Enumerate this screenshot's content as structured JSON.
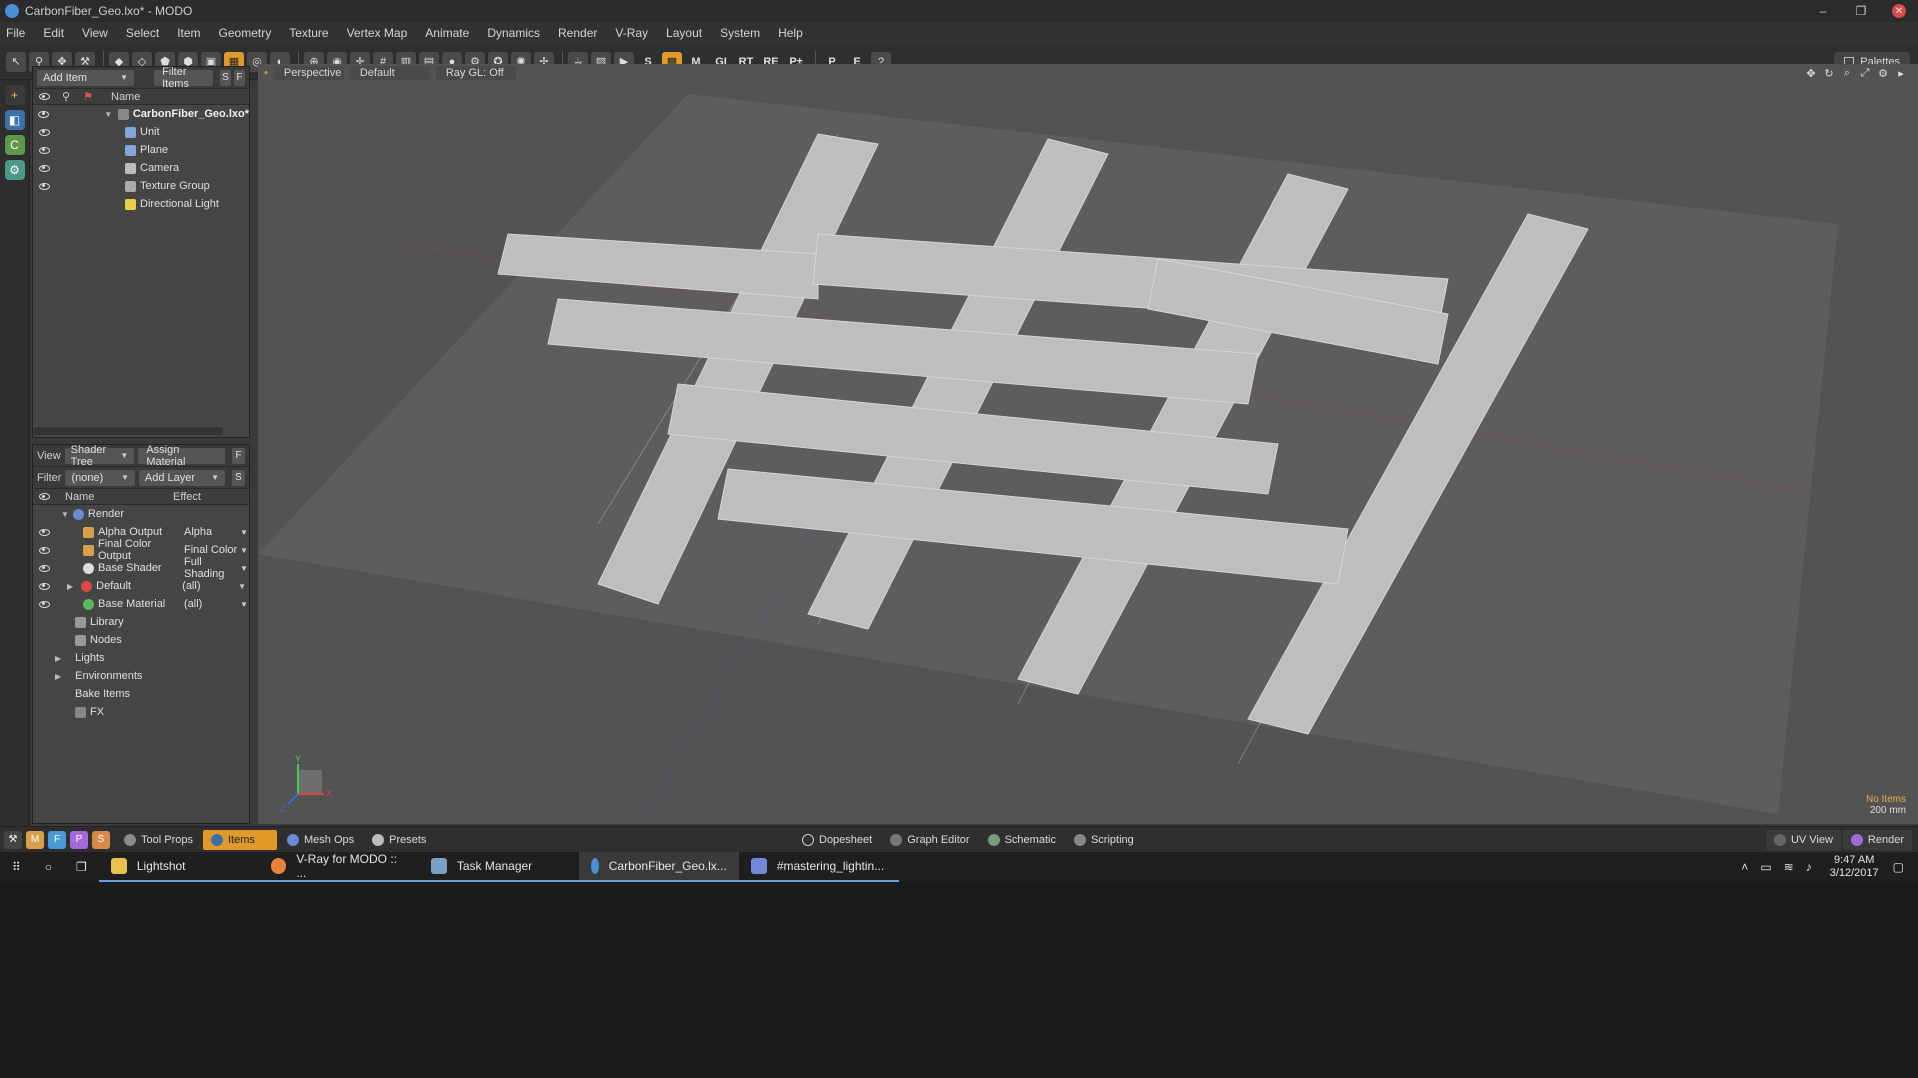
{
  "window": {
    "title": "CarbonFiber_Geo.lxo* - MODO",
    "minimize": "–",
    "restore": "❐",
    "close": "✕"
  },
  "menu": [
    "File",
    "Edit",
    "View",
    "Select",
    "Item",
    "Geometry",
    "Texture",
    "Vertex Map",
    "Animate",
    "Dynamics",
    "Render",
    "V-Ray",
    "Layout",
    "System",
    "Help"
  ],
  "toolbar": {
    "text_buttons": [
      "S",
      "M",
      "GI",
      "RT",
      "RE",
      "P±",
      "P",
      "E",
      "?"
    ],
    "palettes": "Palettes"
  },
  "items_panel": {
    "add_item": "Add Item",
    "filter_items": "Filter Items",
    "btn_s": "S",
    "btn_f": "F",
    "name_header": "Name",
    "scene_name": "CarbonFiber_Geo.lxo*",
    "items": [
      "Unit",
      "Plane",
      "Camera",
      "Texture Group",
      "Directional Light"
    ]
  },
  "shader_panel": {
    "view_label": "View",
    "view_value": "Shader Tree",
    "assign_material": "Assign Material",
    "btn_f": "F",
    "filter_label": "Filter",
    "filter_value": "(none)",
    "add_layer": "Add Layer",
    "btn_s": "S",
    "col_name": "Name",
    "col_effect": "Effect",
    "render": "Render",
    "rows": [
      {
        "name": "Alpha Output",
        "effect": "Alpha"
      },
      {
        "name": "Final Color Output",
        "effect": "Final Color"
      },
      {
        "name": "Base Shader",
        "effect": "Full Shading"
      },
      {
        "name": "Default",
        "effect": "(all)"
      },
      {
        "name": "Base Material",
        "effect": "(all)"
      }
    ],
    "groups": [
      "Library",
      "Nodes",
      "Lights",
      "Environments",
      "Bake Items",
      "FX"
    ]
  },
  "viewport": {
    "tab_perspective": "Perspective",
    "tab_default": "Default",
    "tab_raygl": "Ray GL: Off",
    "no_items": "No Items",
    "scale": "200 mm",
    "axis_x": "X",
    "axis_y": "Y",
    "axis_z": "Z"
  },
  "bottom_tabs": {
    "left": [
      "Tool Props",
      "Items",
      "Mesh Ops",
      "Presets"
    ],
    "mode_letters": [
      "M",
      "F",
      "P",
      "S"
    ],
    "center": [
      "Dopesheet",
      "Graph Editor",
      "Schematic",
      "Scripting"
    ],
    "right": [
      "UV View",
      "Render"
    ]
  },
  "taskbar": {
    "apps": [
      "Lightshot",
      "V-Ray for MODO :: ...",
      "Task Manager",
      "CarbonFiber_Geo.lx...",
      "#mastering_lightin..."
    ],
    "time": "9:47 AM",
    "date": "3/12/2017"
  },
  "colors": {
    "accent": "#e09a2a",
    "panel": "#454545",
    "viewport": "#535353",
    "ground": "#5d5d5d",
    "fiber": "#c4c4c4"
  }
}
